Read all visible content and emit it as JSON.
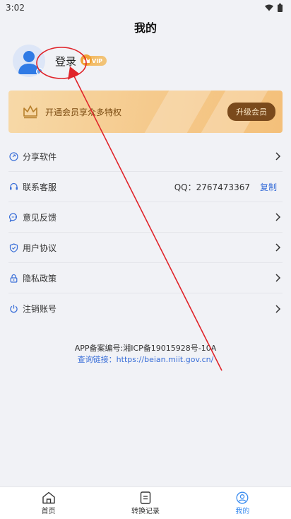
{
  "status": {
    "time": "3:02"
  },
  "header": {
    "title": "我的"
  },
  "profile": {
    "login_label": "登录",
    "vip_badge": "VIP"
  },
  "vip_banner": {
    "text": "开通会员享众多特权",
    "button": "升级会员"
  },
  "menu": {
    "items": [
      {
        "label": "分享软件"
      },
      {
        "label": "联系客服",
        "qq": "QQ：2767473367",
        "copy": "复制"
      },
      {
        "label": "意见反馈"
      },
      {
        "label": "用户协议"
      },
      {
        "label": "隐私政策"
      },
      {
        "label": "注销账号"
      }
    ]
  },
  "beian": {
    "line1": "APP备案编号:湘ICP备19015928号-10A",
    "line2": "查询链接：https://beian.miit.gov.cn/"
  },
  "tabs": [
    {
      "label": "首页"
    },
    {
      "label": "转换记录"
    },
    {
      "label": "我的"
    }
  ],
  "colors": {
    "accent": "#3a8cf0",
    "link": "#3a6fd8",
    "annotation": "#e0242a",
    "vip_button": "#7a4a1c"
  }
}
